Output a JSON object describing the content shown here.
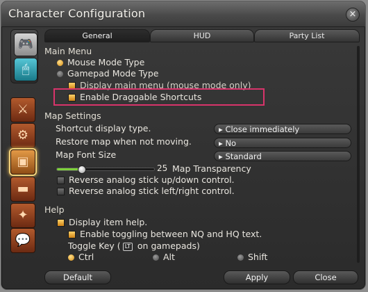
{
  "window": {
    "title": "Character Configuration",
    "close_icon": "×"
  },
  "sidebar": {
    "top_icons": [
      {
        "name": "gamepad-icon",
        "glyph": "🎮"
      },
      {
        "name": "mouse-icon",
        "glyph": "🖱"
      }
    ],
    "category_icons": [
      "⚔",
      "⚙",
      "▣",
      "▬",
      "✦",
      "💬"
    ]
  },
  "tabs": [
    {
      "label": "General"
    },
    {
      "label": "HUD"
    },
    {
      "label": "Party List"
    }
  ],
  "main_menu": {
    "heading": "Main Menu",
    "mouse_mode": "Mouse Mode Type",
    "gamepad_mode": "Gamepad Mode Type",
    "display_main_menu": "Display main menu (mouse mode only)",
    "draggable_shortcuts": "Enable Draggable Shortcuts"
  },
  "map_settings": {
    "heading": "Map Settings",
    "shortcut_display_label": "Shortcut display type.",
    "shortcut_display_value": "Close immediately",
    "restore_map_label": "Restore map when not moving.",
    "restore_map_value": "No",
    "map_font_label": "Map Font Size",
    "map_font_value": "Standard",
    "transparency_value": "25",
    "transparency_label": "Map Transparency",
    "transparency_fraction": 0.25,
    "reverse_updown": "Reverse analog stick up/down control.",
    "reverse_leftright": "Reverse analog stick left/right control."
  },
  "help": {
    "heading": "Help",
    "display_item_help": "Display item help.",
    "enable_nq_hq": "Enable toggling between NQ and HQ text.",
    "toggle_key_prefix": "Toggle Key (",
    "toggle_key_cap": "LT",
    "toggle_key_suffix": " on gamepads)",
    "opt_ctrl": "Ctrl",
    "opt_alt": "Alt",
    "opt_shift": "Shift"
  },
  "buttons": {
    "default": "Default",
    "apply": "Apply",
    "close": "Close"
  }
}
